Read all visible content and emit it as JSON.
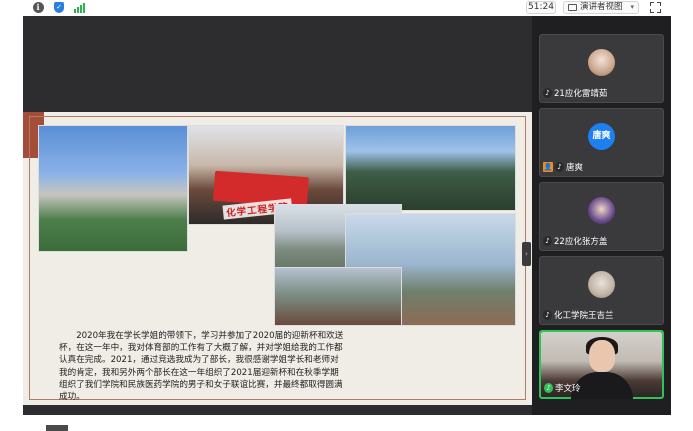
{
  "topbar": {
    "timer": "51:24",
    "view_selector": "演讲者视图"
  },
  "slide": {
    "banner_text": "化学工程学院",
    "body_text": "2020年我在学长学姐的带领下，学习并参加了2020届的迎新杯和欢送杯，在这一年中，我对体育部的工作有了大概了解，并对学姐给我的工作都认真在完成。2021，通过竞选我成为了部长，我很感谢学姐学长和老师对我的肯定，我和另外两个部长在这一年组织了2021届迎新杯和在秋季学期组织了我们学院和民族医药学院的男子和女子联谊比赛，并最终都取得圆满成功。"
  },
  "participants": [
    {
      "name": "21应化雷靖茹",
      "avatar": "photo"
    },
    {
      "name": "唐爽",
      "avatar_text": "唐爽",
      "host": true
    },
    {
      "name": "22应化张方盖",
      "avatar": "photo"
    },
    {
      "name": "化工学院王吉兰",
      "avatar": "photo"
    },
    {
      "name": "李文玲",
      "video": true,
      "active_speaker": true
    }
  ],
  "colors": {
    "active_speaker": "#2fc25b",
    "slide_accent": "#a44d39",
    "host_badge": "#f08a24"
  }
}
